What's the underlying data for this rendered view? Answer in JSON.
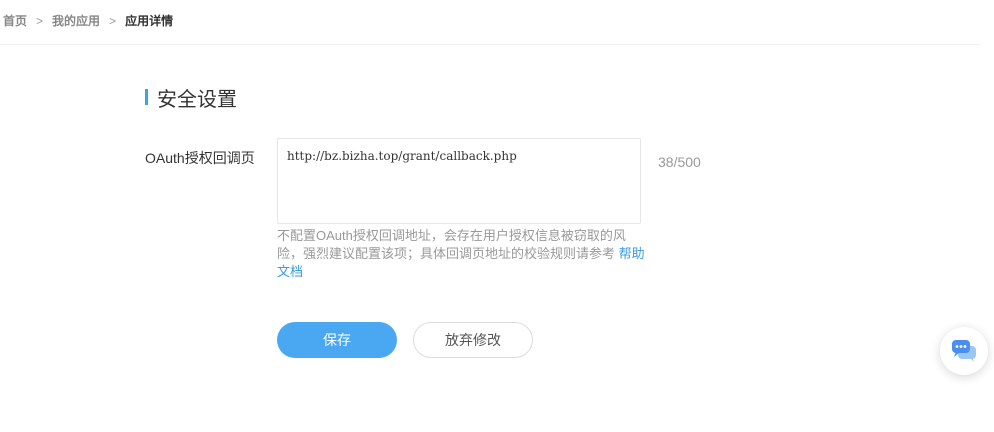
{
  "breadcrumb": {
    "items": [
      "首页",
      "我的应用",
      "应用详情"
    ],
    "separator": ">"
  },
  "section": {
    "title": "安全设置"
  },
  "form": {
    "oauth_label": "OAuth授权回调页",
    "oauth_value": "http://bz.bizha.top/grant/callback.php",
    "char_count": "38/500",
    "hint_text": "不配置OAuth授权回调地址，会存在用户授权信息被窃取的风险，强烈建议配置该项；具体回调页地址的校验规则请参考",
    "hint_link": "帮助文档"
  },
  "actions": {
    "save_label": "保存",
    "discard_label": "放弃修改"
  },
  "icons": {
    "chat": "chat-bubbles-icon"
  },
  "colors": {
    "accent": "#3aa6dd",
    "primary_button": "#4aa8f2",
    "link": "#3a9be3"
  }
}
